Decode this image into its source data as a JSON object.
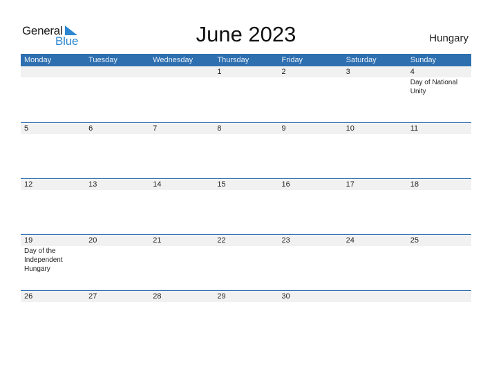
{
  "logo": {
    "general": "General",
    "blue": "Blue"
  },
  "header": {
    "title": "June 2023",
    "country": "Hungary"
  },
  "colors": {
    "accent": "#2e6fb0",
    "row_bg": "#f1f1f1",
    "logo_blue": "#2a86d0"
  },
  "weekdays": [
    "Monday",
    "Tuesday",
    "Wednesday",
    "Thursday",
    "Friday",
    "Saturday",
    "Sunday"
  ],
  "weeks": [
    {
      "days": [
        "",
        "",
        "",
        "1",
        "2",
        "3",
        "4"
      ],
      "events": [
        "",
        "",
        "",
        "",
        "",
        "",
        "Day of National Unity"
      ]
    },
    {
      "days": [
        "5",
        "6",
        "7",
        "8",
        "9",
        "10",
        "11"
      ],
      "events": [
        "",
        "",
        "",
        "",
        "",
        "",
        ""
      ]
    },
    {
      "days": [
        "12",
        "13",
        "14",
        "15",
        "16",
        "17",
        "18"
      ],
      "events": [
        "",
        "",
        "",
        "",
        "",
        "",
        ""
      ]
    },
    {
      "days": [
        "19",
        "20",
        "21",
        "22",
        "23",
        "24",
        "25"
      ],
      "events": [
        "Day of the Independent Hungary",
        "",
        "",
        "",
        "",
        "",
        ""
      ]
    },
    {
      "days": [
        "26",
        "27",
        "28",
        "29",
        "30",
        "",
        ""
      ],
      "events": [
        "",
        "",
        "",
        "",
        "",
        "",
        ""
      ]
    }
  ]
}
